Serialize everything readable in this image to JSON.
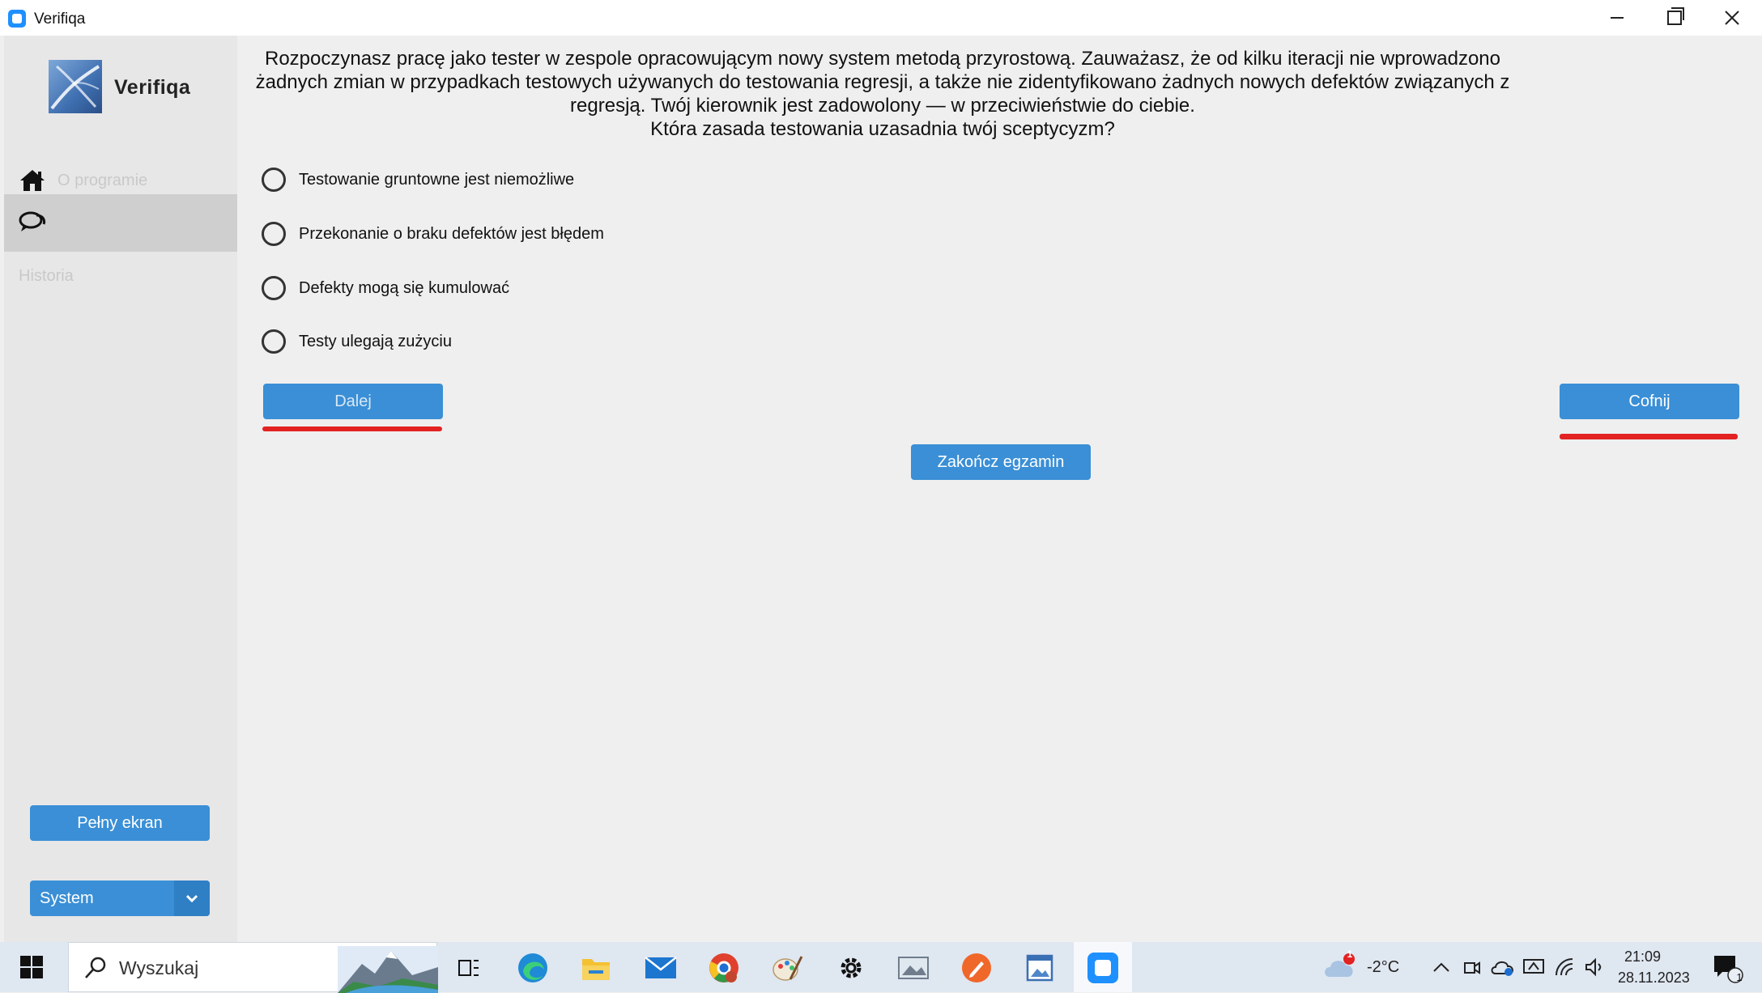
{
  "window": {
    "title": "Verifiqa",
    "controls": [
      "minimize-icon",
      "restore-icon",
      "close-icon"
    ]
  },
  "sidebar": {
    "brand": "Verifiqa",
    "items": [
      {
        "label": "O programie",
        "icon": "home-icon"
      },
      {
        "label": "",
        "icon": "chat-icon",
        "selected": true
      },
      {
        "label": "Historia"
      }
    ],
    "fullscreen_label": "Pełny ekran",
    "theme_select": {
      "value": "System"
    }
  },
  "question": {
    "lines": [
      "Rozpoczynasz pracę jako tester w zespole opracowującym nowy system metodą przyrostową. Zauważasz, że od kilku iteracji nie wprowadzono",
      "żadnych zmian w przypadkach testowych używanych do testowania regresji, a także nie zidentyfikowano żadnych nowych defektów związanych z",
      "regresją. Twój kierownik jest zadowolony — w przeciwieństwie do ciebie.",
      "Która zasada testowania uzasadnia twój sceptycyzm?"
    ],
    "answers": [
      "Testowanie gruntowne jest niemożliwe",
      "Przekonanie o braku defektów jest błędem",
      "Defekty mogą się kumulować",
      "Testy ulegają zużyciu"
    ]
  },
  "buttons": {
    "next": "Dalej",
    "back": "Cofnij",
    "finish": "Zakończ egzamin"
  },
  "taskbar": {
    "search_placeholder": "Wyszukaj",
    "weather": "-2°C",
    "weather_badge": "1",
    "time": "21:09",
    "date": "28.11.2023",
    "notification_count": "1"
  },
  "colors": {
    "accent": "#3a8fd6",
    "underline": "#e32222",
    "sidebar_bg": "#e7e7e7",
    "sidebar_selected": "#cfcfcf",
    "content_bg": "#efefef"
  }
}
